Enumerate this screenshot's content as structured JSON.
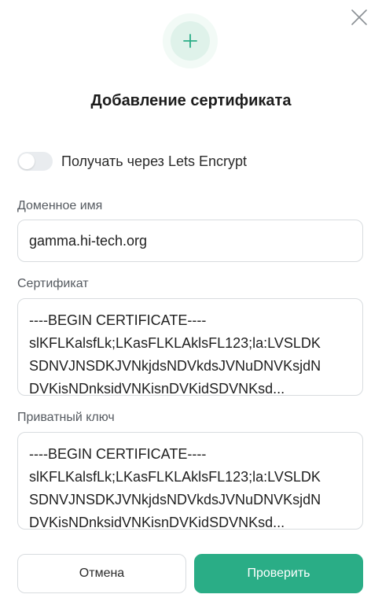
{
  "dialog": {
    "title": "Добавление сертификата",
    "close_icon": "close-icon",
    "header_icon": "plus-icon",
    "accent_color": "#2aad86"
  },
  "lets_encrypt": {
    "label": "Получать через Lets Encrypt",
    "enabled": false
  },
  "domain": {
    "label": "Доменное имя",
    "value": "gamma.hi-tech.org"
  },
  "certificate": {
    "label": "Сертификат",
    "lines": [
      "----BEGIN CERTIFICATE----",
      "slKFLKalsfLk;LKasFLKLAklsFL123;la:LVSLDK",
      "SDNVJNSDKJVNkjdsNDVkdsJVNuDNVKsjdN",
      "DVKisNDnksidVNKisnDVKidSDVNKsd..."
    ]
  },
  "private_key": {
    "label": "Приватный ключ",
    "lines": [
      "----BEGIN CERTIFICATE----",
      "slKFLKalsfLk;LKasFLKLAklsFL123;la:LVSLDK",
      "SDNVJNSDKJVNkjdsNDVkdsJVNuDNVKsjdN",
      "DVKisNDnksidVNKisnDVKidSDVNKsd..."
    ]
  },
  "buttons": {
    "cancel": "Отмена",
    "submit": "Проверить"
  }
}
